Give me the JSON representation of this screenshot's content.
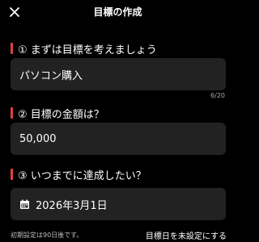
{
  "header": {
    "title": "目標の作成",
    "close_icon": "close-icon"
  },
  "accent_color": "#e04040",
  "goal": {
    "label": "① まずは目標を考えましょう",
    "value": "パソコン購入",
    "counter": "6/20"
  },
  "amount": {
    "label": "② 目標の金額は？",
    "value": "50,000"
  },
  "deadline": {
    "label": "③ いつまでに達成したい？",
    "icon": "calendar-icon",
    "value": "2026年3月1日",
    "note": "初期設定は90日後です。",
    "unset_link": "目標日を未設定にする"
  }
}
